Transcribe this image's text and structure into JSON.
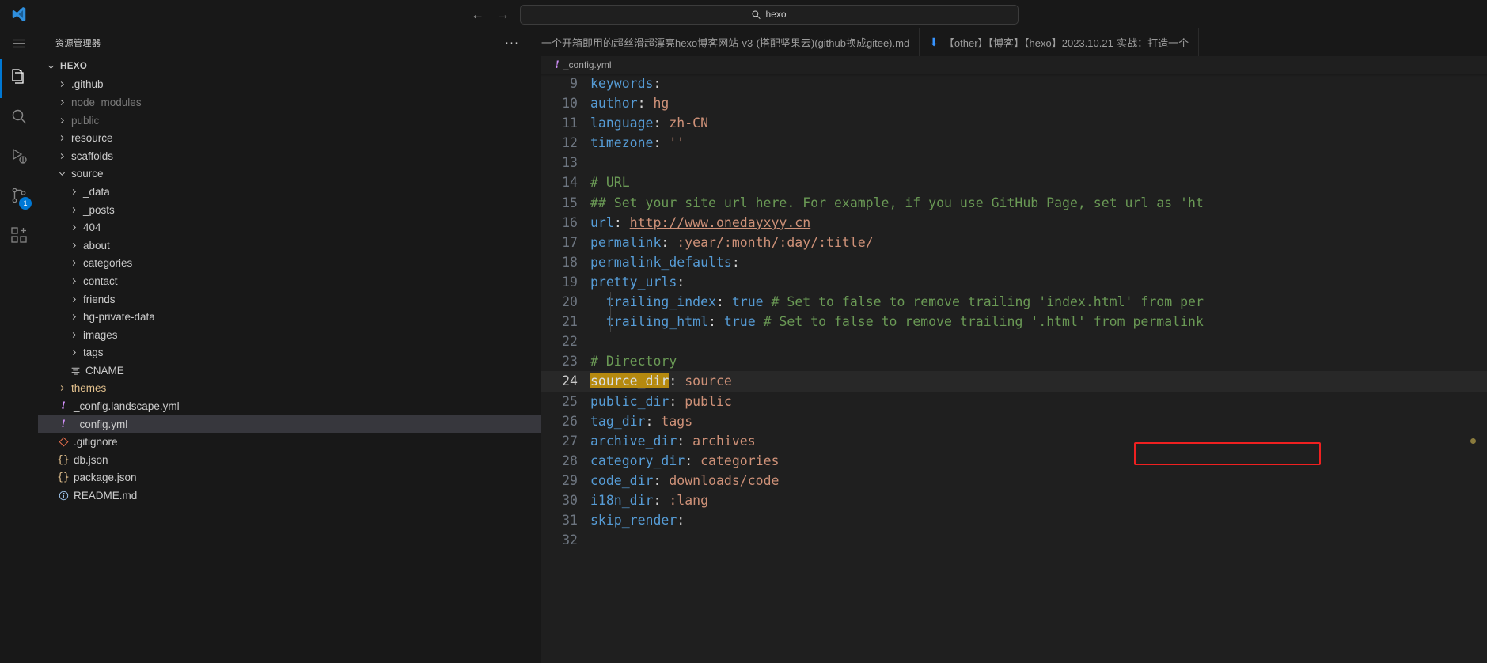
{
  "window": {
    "app_name": "Visual Studio Code",
    "logo_icon": "vscode-logo-icon"
  },
  "titlebar": {
    "back_icon": "arrow-left-icon",
    "forward_icon": "arrow-right-icon",
    "search_icon": "search-icon",
    "command_center_value": "hexo",
    "command_center_placeholder": "搜索"
  },
  "activitybar": {
    "menu_icon": "hamburger-menu-icon",
    "items": [
      {
        "name": "explorer",
        "icon": "files-icon",
        "active": true,
        "badge": ""
      },
      {
        "name": "search",
        "icon": "search-icon",
        "active": false,
        "badge": ""
      },
      {
        "name": "run-and-debug",
        "icon": "run-debug-icon",
        "active": false,
        "badge": ""
      },
      {
        "name": "source-control",
        "icon": "source-control-icon",
        "active": false,
        "badge": "1"
      },
      {
        "name": "extensions",
        "icon": "extensions-icon",
        "active": false,
        "badge": ""
      }
    ]
  },
  "sidebar": {
    "title": "资源管理器",
    "more_actions_label": "···",
    "root": {
      "label": "HEXO",
      "expanded": true
    },
    "tree": [
      {
        "label": ".github",
        "type": "folder",
        "indent": 1,
        "expanded": false,
        "state": "normal"
      },
      {
        "label": "node_modules",
        "type": "folder",
        "indent": 1,
        "expanded": false,
        "state": "dim"
      },
      {
        "label": "public",
        "type": "folder",
        "indent": 1,
        "expanded": false,
        "state": "dim"
      },
      {
        "label": "resource",
        "type": "folder",
        "indent": 1,
        "expanded": false,
        "state": "normal"
      },
      {
        "label": "scaffolds",
        "type": "folder",
        "indent": 1,
        "expanded": false,
        "state": "normal"
      },
      {
        "label": "source",
        "type": "folder",
        "indent": 1,
        "expanded": true,
        "state": "normal"
      },
      {
        "label": "_data",
        "type": "folder",
        "indent": 2,
        "expanded": false,
        "state": "normal"
      },
      {
        "label": "_posts",
        "type": "folder",
        "indent": 2,
        "expanded": false,
        "state": "normal"
      },
      {
        "label": "404",
        "type": "folder",
        "indent": 2,
        "expanded": false,
        "state": "normal"
      },
      {
        "label": "about",
        "type": "folder",
        "indent": 2,
        "expanded": false,
        "state": "normal"
      },
      {
        "label": "categories",
        "type": "folder",
        "indent": 2,
        "expanded": false,
        "state": "normal"
      },
      {
        "label": "contact",
        "type": "folder",
        "indent": 2,
        "expanded": false,
        "state": "normal"
      },
      {
        "label": "friends",
        "type": "folder",
        "indent": 2,
        "expanded": false,
        "state": "normal"
      },
      {
        "label": "hg-private-data",
        "type": "folder",
        "indent": 2,
        "expanded": false,
        "state": "normal"
      },
      {
        "label": "images",
        "type": "folder",
        "indent": 2,
        "expanded": false,
        "state": "normal"
      },
      {
        "label": "tags",
        "type": "folder",
        "indent": 2,
        "expanded": false,
        "state": "normal"
      },
      {
        "label": "CNAME",
        "type": "file",
        "indent": 2,
        "icon": "text-file-icon",
        "state": "normal"
      },
      {
        "label": "themes",
        "type": "folder",
        "indent": 1,
        "expanded": false,
        "state": "modified"
      },
      {
        "label": "_config.landscape.yml",
        "type": "file",
        "indent": 1,
        "icon": "yaml-file-icon",
        "state": "normal"
      },
      {
        "label": "_config.yml",
        "type": "file",
        "indent": 1,
        "icon": "yaml-file-icon",
        "state": "selected"
      },
      {
        "label": ".gitignore",
        "type": "file",
        "indent": 1,
        "icon": "git-file-icon",
        "state": "normal"
      },
      {
        "label": "db.json",
        "type": "file",
        "indent": 1,
        "icon": "json-file-icon",
        "state": "normal"
      },
      {
        "label": "package.json",
        "type": "file",
        "indent": 1,
        "icon": "json-file-icon",
        "state": "normal"
      },
      {
        "label": "README.md",
        "type": "file",
        "indent": 1,
        "icon": "info-markdown-icon",
        "state": "normal"
      }
    ]
  },
  "editor": {
    "tabs": [
      {
        "label": "一个开箱即用的超丝滑超漂亮hexo博客网站-v3-(搭配坚果云)(github换成gitee).md",
        "icon": "markdown-file-icon",
        "active": false
      },
      {
        "label": "【other】【博客】【hexo】2023.10.21-实战：打造一个",
        "icon": "download-arrow-icon",
        "active": false
      }
    ],
    "breadcrumb": {
      "icon": "yaml-file-icon",
      "label": "_config.yml"
    },
    "annotation": {
      "color": "#ef2020",
      "target_line": 24,
      "shape": "rectangle"
    },
    "selection": {
      "text": "source_dir",
      "line": 24,
      "highlight_color": "#b5890f"
    },
    "colors": {
      "key": "#569cd6",
      "value": "#ce9178",
      "comment": "#6a9955",
      "background": "#1f1f1f",
      "gutter": "#6e7681",
      "accent": "#0078d4"
    },
    "lines": [
      {
        "n": 9,
        "tokens": [
          {
            "t": "keywords",
            "c": "k"
          },
          {
            "t": ":",
            "c": "p"
          }
        ]
      },
      {
        "n": 10,
        "tokens": [
          {
            "t": "author",
            "c": "k"
          },
          {
            "t": ": ",
            "c": "p"
          },
          {
            "t": "hg",
            "c": "v"
          }
        ]
      },
      {
        "n": 11,
        "tokens": [
          {
            "t": "language",
            "c": "k"
          },
          {
            "t": ": ",
            "c": "p"
          },
          {
            "t": "zh-CN",
            "c": "v"
          }
        ]
      },
      {
        "n": 12,
        "tokens": [
          {
            "t": "timezone",
            "c": "k"
          },
          {
            "t": ": ",
            "c": "p"
          },
          {
            "t": "''",
            "c": "v"
          }
        ]
      },
      {
        "n": 13,
        "tokens": []
      },
      {
        "n": 14,
        "tokens": [
          {
            "t": "# URL",
            "c": "c"
          }
        ]
      },
      {
        "n": 15,
        "tokens": [
          {
            "t": "## Set your site url here. For example, if you use GitHub Page, set url as 'ht",
            "c": "c"
          }
        ]
      },
      {
        "n": 16,
        "tokens": [
          {
            "t": "url",
            "c": "k"
          },
          {
            "t": ": ",
            "c": "p"
          },
          {
            "t": "http://www.onedayxyy.cn",
            "c": "lnk"
          }
        ]
      },
      {
        "n": 17,
        "tokens": [
          {
            "t": "permalink",
            "c": "k"
          },
          {
            "t": ": ",
            "c": "p"
          },
          {
            "t": ":year/:month/:day/:title/",
            "c": "v"
          }
        ]
      },
      {
        "n": 18,
        "tokens": [
          {
            "t": "permalink_defaults",
            "c": "k"
          },
          {
            "t": ":",
            "c": "p"
          }
        ]
      },
      {
        "n": 19,
        "tokens": [
          {
            "t": "pretty_urls",
            "c": "k"
          },
          {
            "t": ":",
            "c": "p"
          }
        ]
      },
      {
        "n": 20,
        "indent": true,
        "tokens": [
          {
            "t": "  trailing_index",
            "c": "k"
          },
          {
            "t": ": ",
            "c": "p"
          },
          {
            "t": "true",
            "c": "k"
          },
          {
            "t": " # Set to false to remove trailing 'index.html' from per",
            "c": "c"
          }
        ]
      },
      {
        "n": 21,
        "indent": true,
        "tokens": [
          {
            "t": "  trailing_html",
            "c": "k"
          },
          {
            "t": ": ",
            "c": "p"
          },
          {
            "t": "true",
            "c": "k"
          },
          {
            "t": " # Set to false to remove trailing '.html' from permalink",
            "c": "c"
          }
        ]
      },
      {
        "n": 22,
        "tokens": []
      },
      {
        "n": 23,
        "tokens": [
          {
            "t": "# Directory",
            "c": "c"
          }
        ]
      },
      {
        "n": 24,
        "current": true,
        "tokens": [
          {
            "t": "source_dir",
            "c": "sel"
          },
          {
            "t": ": ",
            "c": "p"
          },
          {
            "t": "source",
            "c": "v"
          }
        ]
      },
      {
        "n": 25,
        "tokens": [
          {
            "t": "public_dir",
            "c": "k"
          },
          {
            "t": ": ",
            "c": "p"
          },
          {
            "t": "public",
            "c": "v"
          }
        ]
      },
      {
        "n": 26,
        "tokens": [
          {
            "t": "tag_dir",
            "c": "k"
          },
          {
            "t": ": ",
            "c": "p"
          },
          {
            "t": "tags",
            "c": "v"
          }
        ]
      },
      {
        "n": 27,
        "tokens": [
          {
            "t": "archive_dir",
            "c": "k"
          },
          {
            "t": ": ",
            "c": "p"
          },
          {
            "t": "archives",
            "c": "v"
          }
        ]
      },
      {
        "n": 28,
        "tokens": [
          {
            "t": "category_dir",
            "c": "k"
          },
          {
            "t": ": ",
            "c": "p"
          },
          {
            "t": "categories",
            "c": "v"
          }
        ]
      },
      {
        "n": 29,
        "tokens": [
          {
            "t": "code_dir",
            "c": "k"
          },
          {
            "t": ": ",
            "c": "p"
          },
          {
            "t": "downloads/code",
            "c": "v"
          }
        ]
      },
      {
        "n": 30,
        "tokens": [
          {
            "t": "i18n_dir",
            "c": "k"
          },
          {
            "t": ": ",
            "c": "p"
          },
          {
            "t": ":lang",
            "c": "v"
          }
        ]
      },
      {
        "n": 31,
        "tokens": [
          {
            "t": "skip_render",
            "c": "k"
          },
          {
            "t": ":",
            "c": "p"
          }
        ]
      },
      {
        "n": 32,
        "tokens": []
      }
    ]
  }
}
